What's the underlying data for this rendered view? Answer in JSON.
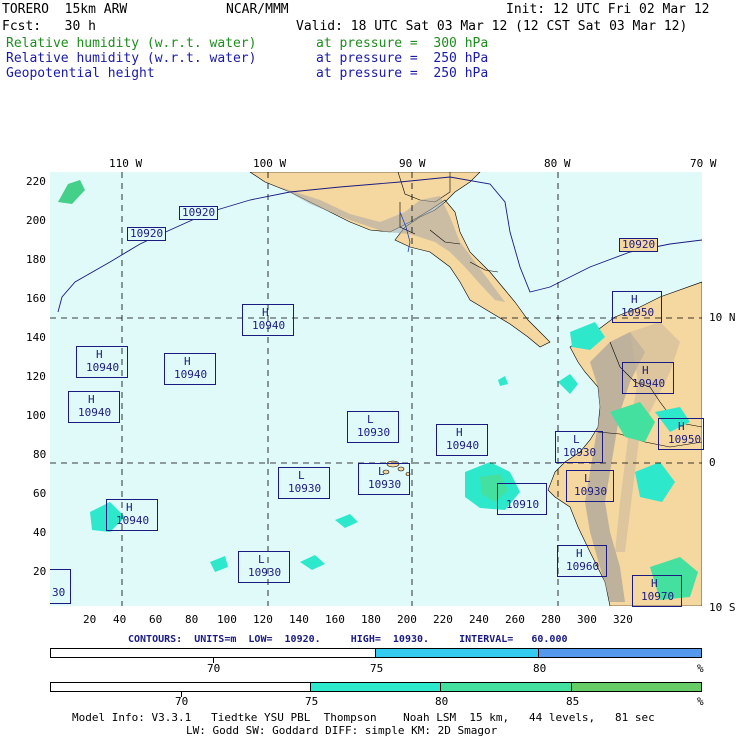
{
  "header": {
    "model": "TORERO  15km ARW",
    "org": "NCAR/MMM",
    "init": "Init: 12 UTC Fri 02 Mar 12",
    "fcst": "Fcst:   30 h",
    "valid": "Valid: 18 UTC Sat 03 Mar 12 (12 CST Sat 03 Mar 12)",
    "fields": [
      {
        "name": "Relative humidity (w.r.t. water)",
        "level": "at pressure =  300 hPa",
        "color": "#1e8c1e"
      },
      {
        "name": "Relative humidity (w.r.t. water)",
        "level": "at pressure =  250 hPa",
        "color": "#1a1aa8"
      },
      {
        "name": "Geopotential height",
        "level": "at pressure =  250 hPa",
        "color": "#1a1aa8"
      }
    ]
  },
  "map": {
    "top_lon_labels": [
      "110 W",
      "100 W",
      "90 W",
      "80 W",
      "70 W"
    ],
    "right_lat_labels": [
      "10 N",
      "0",
      "10 S"
    ],
    "left_grid_labels": [
      "220",
      "200",
      "180",
      "160",
      "140",
      "120",
      "100",
      "80",
      "60",
      "40",
      "20"
    ],
    "bottom_grid_labels": [
      "20",
      "40",
      "60",
      "80",
      "100",
      "120",
      "140",
      "160",
      "180",
      "200",
      "220",
      "240",
      "260",
      "280",
      "300",
      "320"
    ],
    "ocean_color": "#e0fafa",
    "land_color": "#f5d7a0",
    "contour_labels": [
      "10920",
      "10920",
      "10920"
    ],
    "centers": [
      {
        "type": "H",
        "value": "10940"
      },
      {
        "type": "H",
        "value": "10940"
      },
      {
        "type": "H",
        "value": "10940"
      },
      {
        "type": "H",
        "value": "10940"
      },
      {
        "type": "L",
        "value": "10930"
      },
      {
        "type": "H",
        "value": "10940"
      },
      {
        "type": "L",
        "value": "10930"
      },
      {
        "type": "L",
        "value": "10930"
      },
      {
        "type": "L",
        "value": "10930"
      },
      {
        "type": "H",
        "value": "10940"
      },
      {
        "type": "L",
        "value": "10930"
      },
      {
        "type": "L",
        "value": "10930"
      },
      {
        "type": "H",
        "value": "10950"
      },
      {
        "type": "H",
        "value": "10940"
      },
      {
        "type": "H",
        "value": "10950"
      },
      {
        "type": "H",
        "value": "10960"
      },
      {
        "type": "H",
        "value": "10970"
      },
      {
        "type": "",
        "value": "10910"
      },
      {
        "type": "",
        "value": "30"
      }
    ]
  },
  "contour_info": "CONTOURS:  UNITS=m  LOW=  10920.     HIGH=  10930.     INTERVAL=   60.000",
  "colorbar_250": {
    "segments": [
      "#ffffff",
      "#33ccf0",
      "#5599ee"
    ],
    "labels": [
      "70",
      "75",
      "80",
      "%"
    ]
  },
  "colorbar_300": {
    "segments": [
      "#ffffff",
      "#2ee8cc",
      "#44e0a0",
      "#66cc66"
    ],
    "labels": [
      "70",
      "75",
      "80",
      "85",
      "%"
    ]
  },
  "footer": {
    "line1": "Model Info: V3.3.1   Tiedtke YSU PBL  Thompson    Noah LSM  15 km,   44 levels,   81 sec",
    "line2": "LW: Godd SW: Goddard DIFF: simple KM: 2D Smagor"
  }
}
